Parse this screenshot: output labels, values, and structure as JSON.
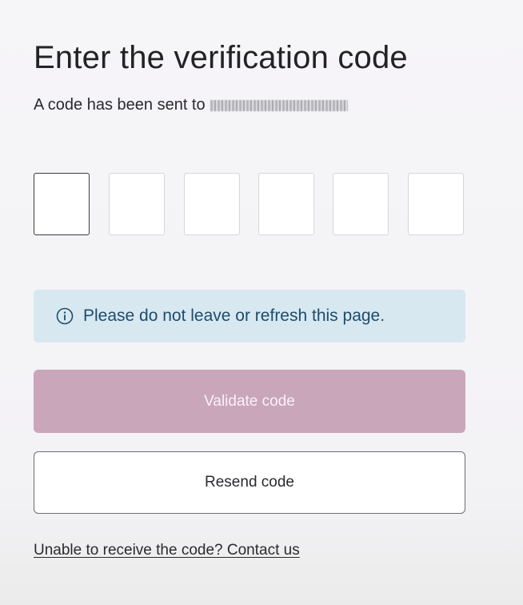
{
  "header": {
    "title": "Enter the verification code",
    "subtitle_prefix": "A code has been sent to"
  },
  "otp": {
    "length": 6,
    "values": [
      "",
      "",
      "",
      "",
      "",
      ""
    ],
    "active_index": 0
  },
  "alert": {
    "icon": "info-icon",
    "message": "Please do not leave or refresh this page."
  },
  "actions": {
    "validate_label": "Validate code",
    "validate_enabled": false,
    "resend_label": "Resend code"
  },
  "footer": {
    "contact_link": "Unable to receive the code? Contact us"
  },
  "colors": {
    "primary_disabled": "#caa6bb",
    "info_bg": "#d8e8f1",
    "info_text": "#1d4c6c"
  }
}
